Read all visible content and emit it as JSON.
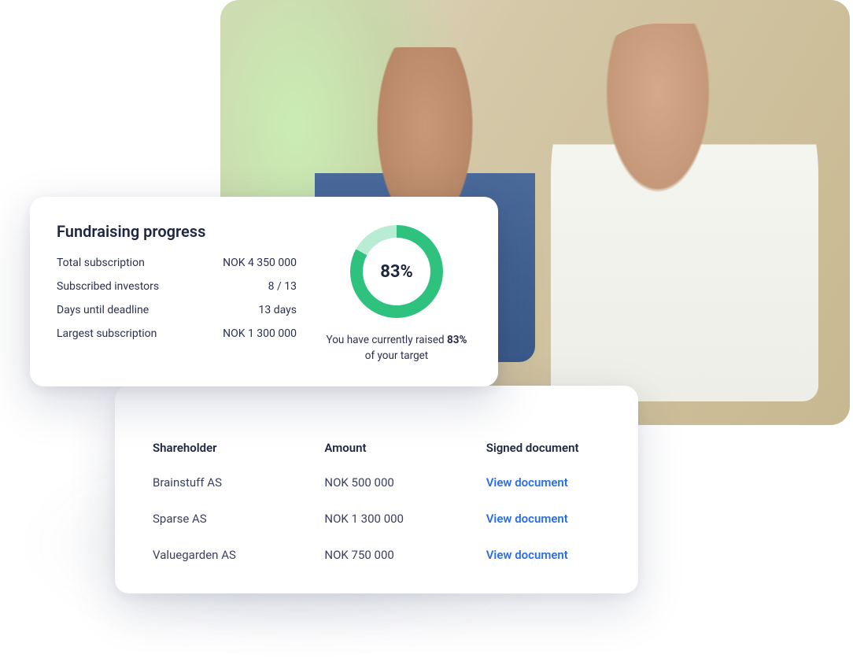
{
  "progress": {
    "title": "Fundraising progress",
    "stats": [
      {
        "label": "Total subscription",
        "value": "NOK 4 350 000"
      },
      {
        "label": "Subscribed investors",
        "value": "8 / 13"
      },
      {
        "label": "Days until deadline",
        "value": "13 days"
      },
      {
        "label": "Largest subscription",
        "value": "NOK 1 300 000"
      }
    ],
    "percent_label": "83%",
    "percent_value": 83,
    "caption_prefix": "You have currently raised ",
    "caption_bold": "83%",
    "caption_suffix": " of your target"
  },
  "table": {
    "headers": {
      "shareholder": "Shareholder",
      "amount": "Amount",
      "doc": "Signed document"
    },
    "rows": [
      {
        "shareholder": "Brainstuff AS",
        "amount": "NOK 500 000",
        "link": "View document"
      },
      {
        "shareholder": "Sparse AS",
        "amount": "NOK 1 300 000",
        "link": "View document"
      },
      {
        "shareholder": "Valuegarden AS",
        "amount": "NOK 750 000",
        "link": "View document"
      }
    ]
  },
  "colors": {
    "accent_green": "#2ec27e",
    "accent_green_light": "#b8ecd4",
    "link_blue": "#2a6fe8",
    "text_dark": "#1e2640"
  }
}
